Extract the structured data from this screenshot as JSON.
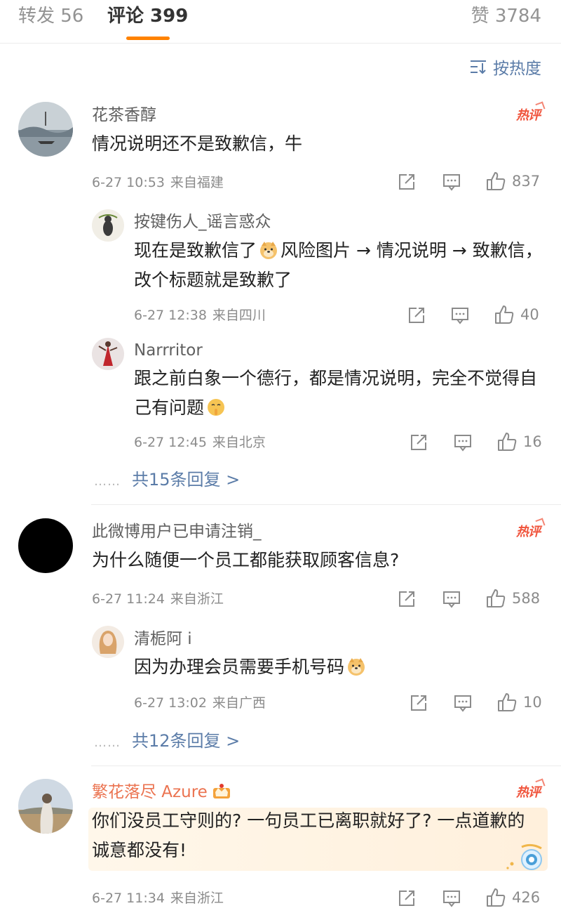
{
  "tabs": {
    "repost": "转发 56",
    "comments": "评论 399",
    "likes": "赞 3784"
  },
  "sort": {
    "label": "按热度"
  },
  "hot_badge": "热评",
  "comments": [
    {
      "user": "花茶香醇",
      "text": "情况说明还不是致歉信，牛",
      "date": "6-27 10:53",
      "location": "来自福建",
      "likes": "837",
      "hot": true,
      "replies": [
        {
          "user": "按键伤人_谣言惑众",
          "text_a": "现在是致歉信了",
          "text_b": "风险图片 → 情况说明 → 致歉信，改个标题就是致歉了",
          "date": "6-27 12:38",
          "location": "来自四川",
          "likes": "40"
        },
        {
          "user": "Narrritor",
          "text": "跟之前白象一个德行，都是情况说明，完全不觉得自己有问题",
          "date": "6-27 12:45",
          "location": "来自北京",
          "likes": "16"
        }
      ],
      "more_replies": "共15条回复 >"
    },
    {
      "user": "此微博用户已申请注销_",
      "text": "为什么随便一个员工都能获取顾客信息?",
      "date": "6-27 11:24",
      "location": "来自浙江",
      "likes": "588",
      "hot": true,
      "replies": [
        {
          "user": "清栀阿 i",
          "text": "因为办理会员需要手机号码",
          "date": "6-27 13:02",
          "location": "来自广西",
          "likes": "10"
        }
      ],
      "more_replies": "共12条回复 >"
    },
    {
      "user": "繁花落尽 Azure",
      "text": "你们没员工守则的? 一句员工已离职就好了? 一点道歉的诚意都没有!",
      "date": "6-27 11:34",
      "location": "来自浙江",
      "likes": "426",
      "hot": true
    }
  ],
  "more_dots": "……",
  "colors": {
    "accent": "#ff8200",
    "link": "#5b7ca8",
    "hot": "#f0543c",
    "vip_name": "#eb7350"
  }
}
